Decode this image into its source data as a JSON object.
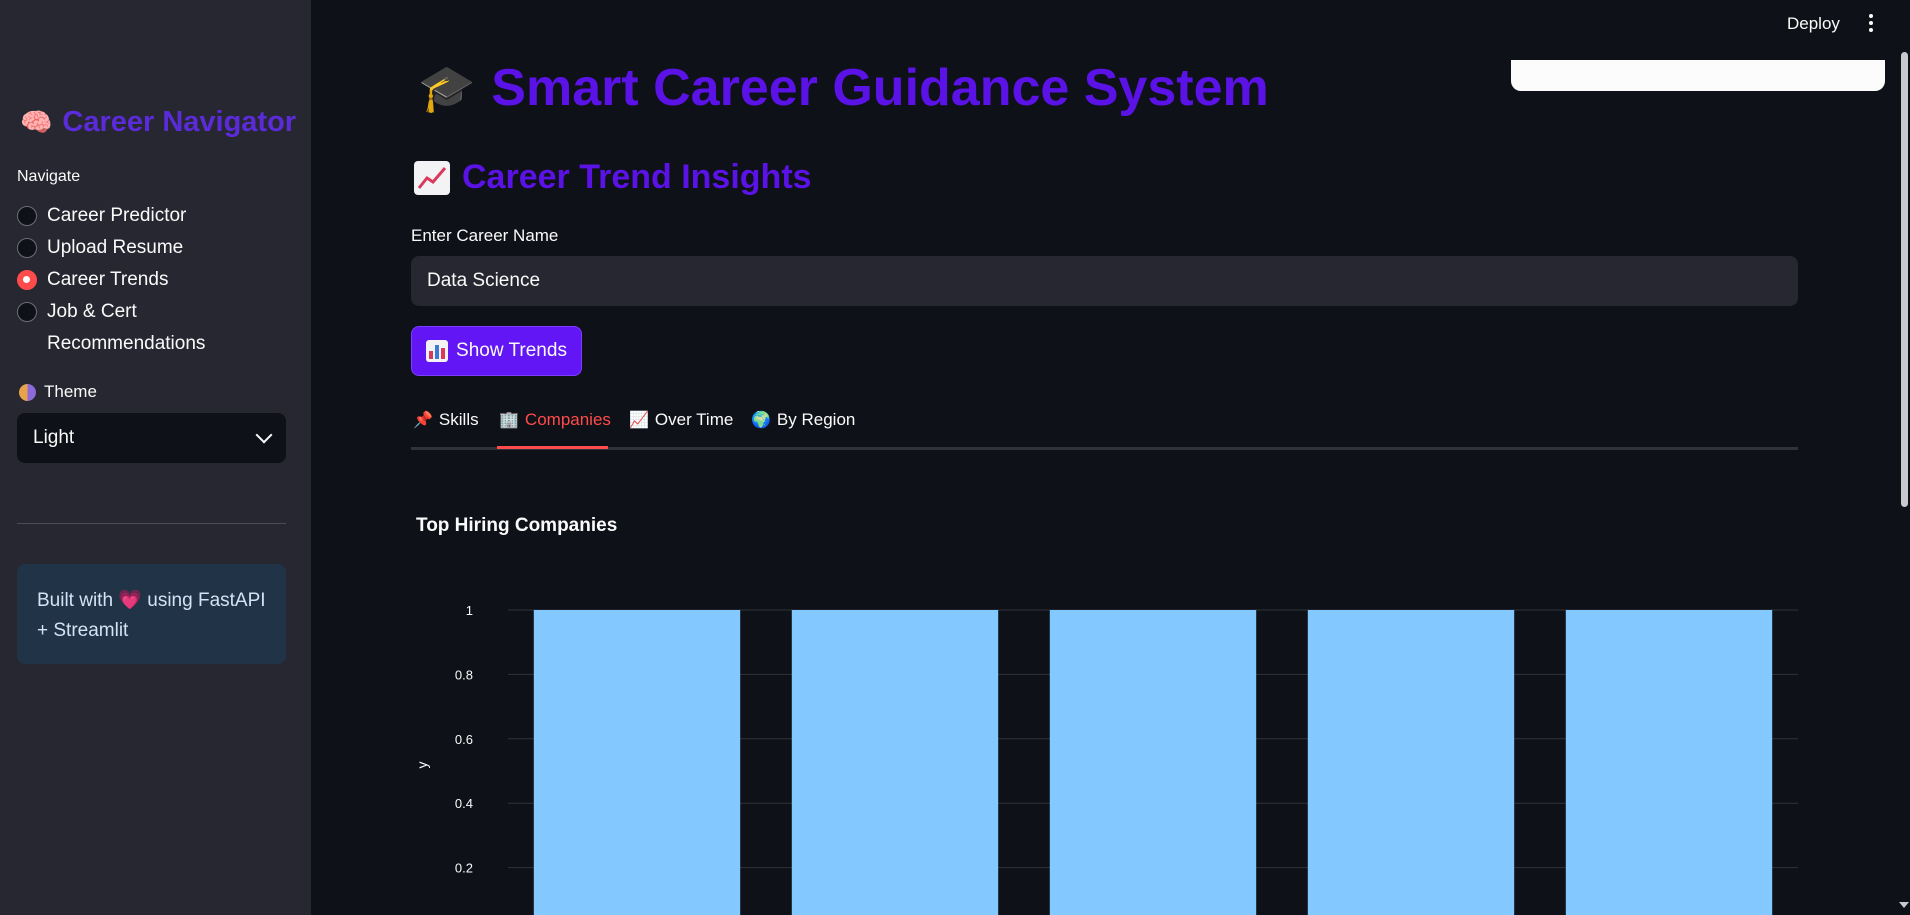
{
  "header": {
    "deploy_label": "Deploy"
  },
  "sidebar": {
    "app_icon": "brain-icon",
    "title": "Career Navigator",
    "nav_label": "Navigate",
    "items": [
      {
        "label": "Career Predictor",
        "checked": false
      },
      {
        "label": "Upload Resume",
        "checked": false
      },
      {
        "label": "Career Trends",
        "checked": true
      },
      {
        "label": "Job & Cert",
        "label2": "Recommendations",
        "checked": false
      }
    ],
    "theme_label": "Theme",
    "theme_value": "Light",
    "info_text": "Built with",
    "info_text2": "using FastAPI",
    "info_text3": "+ Streamlit"
  },
  "main": {
    "title": "Smart Career Guidance System",
    "subtitle": "Career Trend Insights",
    "input_label": "Enter Career Name",
    "input_value": "Data Science",
    "button_label": "Show Trends",
    "tabs": [
      {
        "label": "Skills",
        "icon": "pushpin-icon"
      },
      {
        "label": "Companies",
        "icon": "office-building-icon"
      },
      {
        "label": "Over Time",
        "icon": "chart-increasing-icon"
      },
      {
        "label": "By Region",
        "icon": "globe-icon"
      }
    ],
    "active_tab": "Companies"
  },
  "chart_data": {
    "type": "bar",
    "title": "Top Hiring Companies",
    "ylabel": "y",
    "xlabel": "",
    "ylim": [
      0,
      1
    ],
    "yticks": [
      "0.2",
      "0.4",
      "0.6",
      "0.8",
      "1"
    ],
    "values": [
      1,
      1,
      1,
      1,
      1
    ],
    "bar_color": "#83c9ff",
    "grid": true
  },
  "colors": {
    "accent": "#5a12e6",
    "danger": "#ff4b4b",
    "bar": "#83c9ff"
  }
}
